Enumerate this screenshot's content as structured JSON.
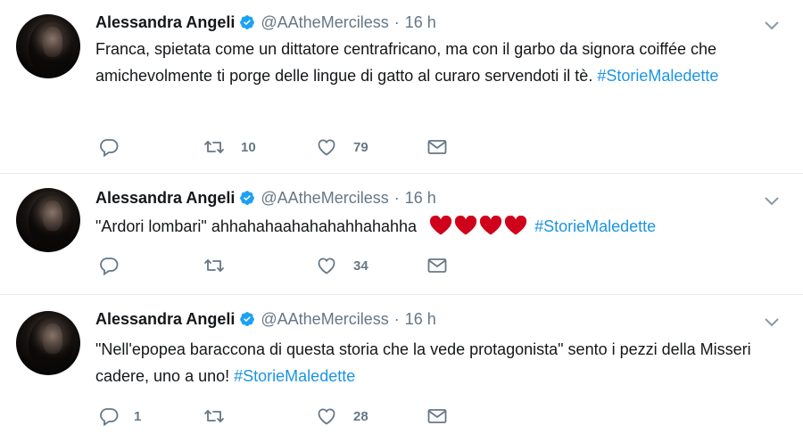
{
  "tweets": [
    {
      "author": {
        "name": "Alessandra Angeli",
        "handle": "@AAtheMerciless",
        "verified": true
      },
      "time": "16 h",
      "text": "Franca, spietata come un dittatore centrafricano, ma con il garbo da signora coiffée che amichevolmente ti porge delle lingue di gatto al curaro servendoti il tè.",
      "hashtag": "#StorieMaledette",
      "actions": {
        "replies": "",
        "retweets": "10",
        "likes": "79"
      }
    },
    {
      "author": {
        "name": "Alessandra Angeli",
        "handle": "@AAtheMerciless",
        "verified": true
      },
      "time": "16 h",
      "text": "\"Ardori lombari\" ahhahahaahahahahhahahha",
      "emoji": "red-heart x4",
      "hashtag": "#StorieMaledette",
      "actions": {
        "replies": "",
        "retweets": "",
        "likes": "34"
      }
    },
    {
      "author": {
        "name": "Alessandra Angeli",
        "handle": "@AAtheMerciless",
        "verified": true
      },
      "time": "16 h",
      "text": "\"Nell'epopea baraccona di questa storia che la vede protagonista\" sento i pezzi della Misseri cadere, uno a uno!",
      "hashtag": "#StorieMaledette",
      "actions": {
        "replies": "1",
        "retweets": "",
        "likes": "28"
      }
    }
  ],
  "colors": {
    "text": "#14171a",
    "secondary": "#657786",
    "link": "#1b95e0",
    "verified": "#1da1f2",
    "heart": "#d0021b",
    "divider": "#e6ecf0"
  },
  "icons": [
    "reply-icon",
    "retweet-icon",
    "like-icon",
    "direct-message-icon",
    "verified-badge-icon",
    "caret-down-icon",
    "red-heart-emoji"
  ]
}
